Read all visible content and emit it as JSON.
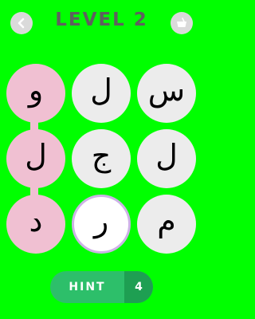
{
  "header": {
    "title": "LEVEL 2",
    "back_icon": "chevron-left-icon",
    "shop_icon": "basket-icon"
  },
  "grid": {
    "rows": [
      [
        {
          "letter": "و",
          "state": "selected"
        },
        {
          "letter": "ل",
          "state": "idle"
        },
        {
          "letter": "س",
          "state": "idle"
        }
      ],
      [
        {
          "letter": "ل",
          "state": "selected"
        },
        {
          "letter": "ج",
          "state": "idle"
        },
        {
          "letter": "ل",
          "state": "idle"
        }
      ],
      [
        {
          "letter": "د",
          "state": "selected"
        },
        {
          "letter": "ر",
          "state": "active"
        },
        {
          "letter": "م",
          "state": "idle"
        }
      ]
    ]
  },
  "hint": {
    "label": "HINT",
    "count": "4"
  },
  "colors": {
    "background": "#00ff00",
    "tile": "#ececec",
    "selected_tile": "#f0c0d2",
    "active_ring": "#cdb2e6",
    "hint_button": "#2dbf6a",
    "hint_count_bg": "#1e9f52",
    "title_text": "#5f5f5f"
  }
}
